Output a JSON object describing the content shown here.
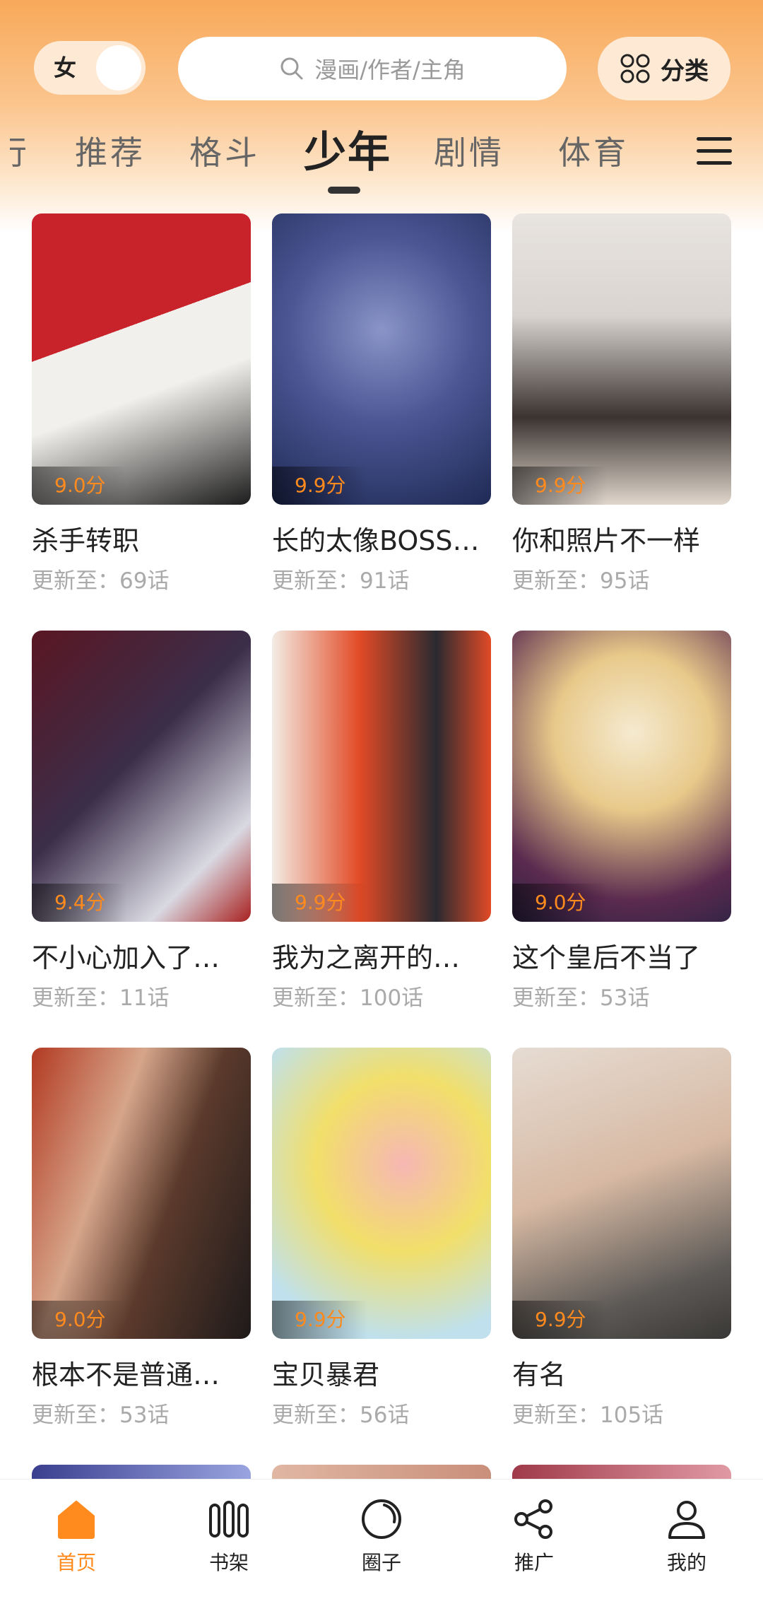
{
  "header": {
    "gender_label": "女",
    "search_placeholder": "漫画/作者/主角",
    "category_label": "分类"
  },
  "tabs": [
    {
      "label": "行"
    },
    {
      "label": "推荐"
    },
    {
      "label": "格斗"
    },
    {
      "label": "少年",
      "active": true
    },
    {
      "label": "剧情"
    },
    {
      "label": "体育"
    }
  ],
  "comics": [
    {
      "title": "杀手转职",
      "score": "9.0分",
      "update": "更新至：69话",
      "colors": [
        "#c8232b",
        "#f2f0ec"
      ]
    },
    {
      "title": "长的太像BOSS…",
      "score": "9.9分",
      "update": "更新至：91话",
      "colors": [
        "#1f2a55",
        "#8a94c7"
      ]
    },
    {
      "title": "你和照片不一样",
      "score": "9.9分",
      "update": "更新至：95话",
      "colors": [
        "#d9d4cf",
        "#3a3330"
      ]
    },
    {
      "title": "不小心加入了…",
      "score": "9.4分",
      "update": "更新至：11话",
      "colors": [
        "#5a1622",
        "#d9d9e2"
      ]
    },
    {
      "title": "我为之离开的…",
      "score": "9.9分",
      "update": "更新至：100话",
      "colors": [
        "#e24a26",
        "#2a2a30"
      ]
    },
    {
      "title": "这个皇后不当了",
      "score": "9.0分",
      "update": "更新至：53话",
      "colors": [
        "#f5ead0",
        "#5b2a4f"
      ]
    },
    {
      "title": "根本不是普通…",
      "score": "9.0分",
      "update": "更新至：53话",
      "colors": [
        "#5b3a2c",
        "#b23a22"
      ]
    },
    {
      "title": "宝贝暴君",
      "score": "9.9分",
      "update": "更新至：56话",
      "colors": [
        "#bfe0ec",
        "#f6b7b4"
      ]
    },
    {
      "title": "有名",
      "score": "9.9分",
      "update": "更新至：105话",
      "colors": [
        "#e6dcd3",
        "#5c5956"
      ]
    }
  ],
  "bottom_nav": [
    {
      "label": "首页",
      "icon": "home-icon",
      "active": true
    },
    {
      "label": "书架",
      "icon": "bookshelf-icon"
    },
    {
      "label": "圈子",
      "icon": "circle-icon"
    },
    {
      "label": "推广",
      "icon": "share-icon"
    },
    {
      "label": "我的",
      "icon": "profile-icon"
    }
  ],
  "colors": {
    "accent": "#ff8a1e",
    "header_gradient_top": "#f8a95a"
  }
}
